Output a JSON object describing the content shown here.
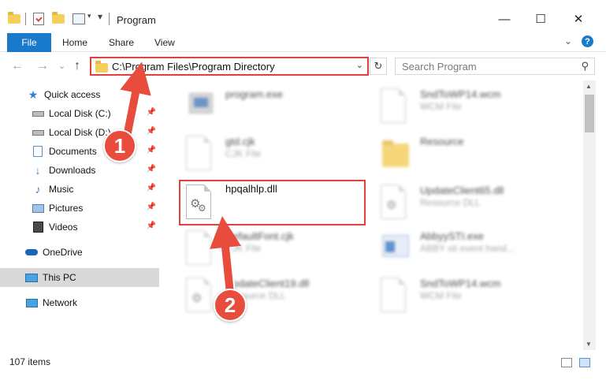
{
  "window": {
    "title": "Program",
    "minimize_glyph": "—",
    "maximize_glyph": "☐",
    "close_glyph": "✕"
  },
  "ribbon": {
    "file_label": "File",
    "tabs": [
      "Home",
      "Share",
      "View"
    ],
    "help_glyph": "?",
    "expand_glyph": "⌄"
  },
  "nav": {
    "back_glyph": "←",
    "forward_glyph": "→",
    "dropdown_glyph": "⌄",
    "up_glyph": "↑",
    "address": "C:\\Program Files\\Program Directory",
    "address_drop_glyph": "⌄",
    "refresh_glyph": "↻",
    "search_placeholder": "Search Program",
    "search_glyph": "⚲"
  },
  "sidebar": {
    "items": [
      {
        "label": "Quick access",
        "icon": "star-icon"
      },
      {
        "label": "Local Disk (C:)",
        "icon": "drive-icon"
      },
      {
        "label": "Local Disk (D:)",
        "icon": "drive-icon"
      },
      {
        "label": "Documents",
        "icon": "documents-icon"
      },
      {
        "label": "Downloads",
        "icon": "download-icon"
      },
      {
        "label": "Music",
        "icon": "music-icon"
      },
      {
        "label": "Pictures",
        "icon": "pictures-icon"
      },
      {
        "label": "Videos",
        "icon": "video-icon"
      },
      {
        "label": "OneDrive",
        "icon": "cloud-icon"
      },
      {
        "label": "This PC",
        "icon": "computer-icon"
      },
      {
        "label": "Network",
        "icon": "network-icon"
      }
    ],
    "pin_glyph": "📌"
  },
  "files": [
    {
      "name": "program.exe",
      "type": ""
    },
    {
      "name": "SndToWP14.wcm",
      "type": "WCM File"
    },
    {
      "name": "gtd.cjk",
      "type": "CJK File"
    },
    {
      "name": "Resource",
      "type": ""
    },
    {
      "name": "hpqalhlp.dll",
      "type": ""
    },
    {
      "name": "UpdateClient65.dll",
      "type": "Resource DLL"
    },
    {
      "name": "DefaultFont.cjk",
      "type": "CJK File"
    },
    {
      "name": "AbbyySTI.exe",
      "type": "ABBY sti event hand..."
    },
    {
      "name": "UpdateClient19.dll",
      "type": "Resource DLL"
    },
    {
      "name": "SndToWP14.wcm",
      "type": "WCM File"
    }
  ],
  "status": {
    "item_count": "107 items"
  },
  "annotations": {
    "step1": "1",
    "step2": "2"
  },
  "colors": {
    "accent": "#1979ca",
    "highlight": "#e0413a",
    "badge": "#e74c3c"
  }
}
